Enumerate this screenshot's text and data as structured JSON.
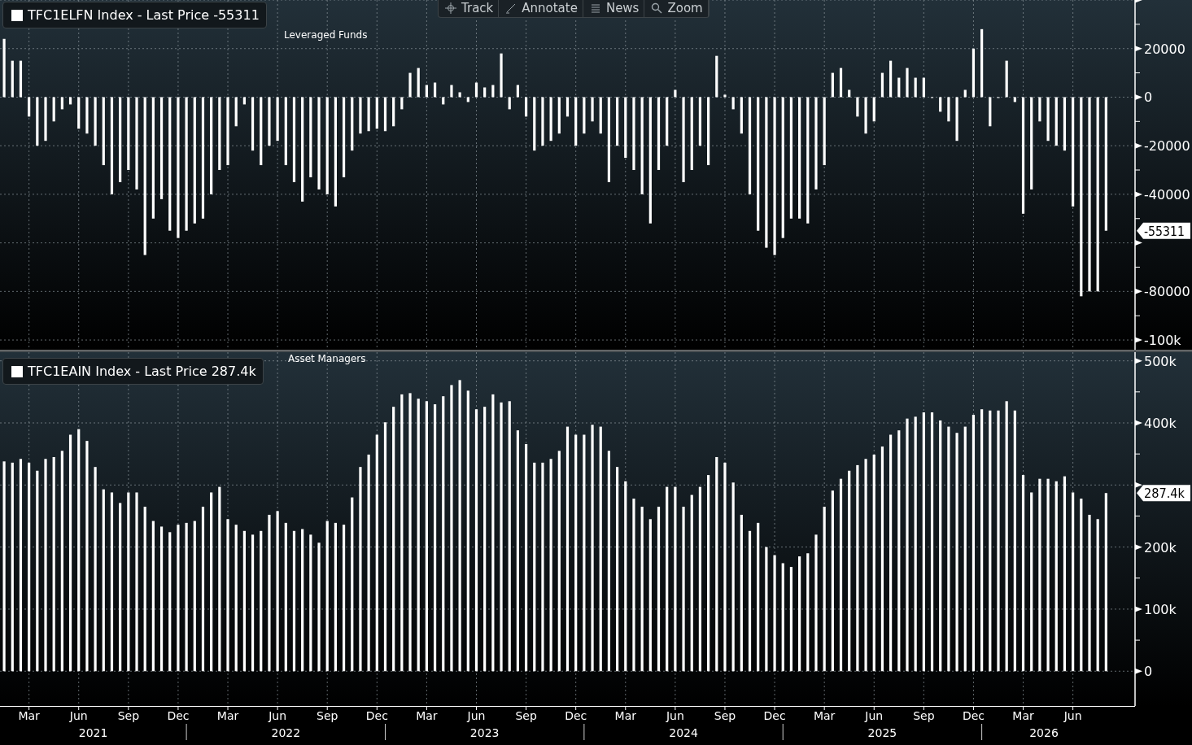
{
  "toolbar": [
    {
      "label": "Track",
      "kind": "track"
    },
    {
      "label": "Annotate",
      "kind": "annotate"
    },
    {
      "label": "News",
      "kind": "news"
    },
    {
      "label": "Zoom",
      "kind": "zoom"
    }
  ],
  "panels": [
    {
      "legend": "TFC1ELFN Index - Last Price -55311",
      "subtitle": "Leveraged Funds",
      "last_tag": "-55311",
      "chart_data": {
        "type": "bar",
        "grid": true,
        "ylim": [
          -104000,
          40000
        ],
        "yticks": [
          {
            "value": 20000,
            "label": "20000"
          },
          {
            "value": 0,
            "label": "0"
          },
          {
            "value": -20000,
            "label": "-20000"
          },
          {
            "value": -40000,
            "label": "-40000"
          },
          {
            "value": -80000,
            "label": "-80000"
          },
          {
            "value": -100000,
            "label": "-100k"
          }
        ],
        "categories": [
          null,
          null,
          null,
          null,
          null,
          null,
          null,
          null,
          null,
          null,
          null,
          null,
          null,
          null,
          null,
          null,
          null,
          null,
          null,
          null,
          null,
          null,
          null,
          null,
          null,
          null,
          null,
          null,
          null,
          null,
          null,
          null,
          null,
          null,
          null,
          null,
          null,
          null,
          null,
          null,
          null,
          null,
          null,
          null,
          null,
          null,
          null,
          null,
          null,
          null,
          null,
          null,
          null,
          null,
          null,
          null,
          null,
          null,
          null,
          null,
          null,
          null,
          null,
          null,
          null,
          null,
          null,
          null,
          null,
          null,
          null,
          null,
          null,
          null,
          null,
          null,
          null,
          null,
          null,
          null,
          null,
          null,
          null,
          null,
          null,
          null,
          null,
          null,
          null,
          null,
          null,
          null,
          null,
          null,
          null,
          null,
          null,
          null,
          null,
          null,
          null,
          null,
          null,
          null,
          null,
          null,
          null,
          null,
          null,
          null,
          null,
          null,
          null,
          null,
          null,
          null,
          null,
          null,
          null,
          null,
          null,
          null,
          null,
          null,
          null,
          null,
          null,
          null,
          null,
          null,
          null,
          null,
          null,
          null,
          null,
          null,
          null
        ],
        "series": [
          {
            "color": "#ffffff",
            "values": [
              24000,
              15000,
              15000,
              -8000,
              -20000,
              -18000,
              -10000,
              -5000,
              -3000,
              -13000,
              -15000,
              -20000,
              -28000,
              -40000,
              -35000,
              -30000,
              -38000,
              -65000,
              -50000,
              -42000,
              -55000,
              -58000,
              -55000,
              -52000,
              -50000,
              -40000,
              -30000,
              -28000,
              -12000,
              -3000,
              -22000,
              -28000,
              -20000,
              -18000,
              -28000,
              -35000,
              -43000,
              -33000,
              -38000,
              -40000,
              -45000,
              -33000,
              -22000,
              -15000,
              -14000,
              -13000,
              -14000,
              -12000,
              -5000,
              10000,
              12000,
              5000,
              6000,
              -3000,
              5000,
              2000,
              -2000,
              6000,
              4000,
              5000,
              18000,
              -5000,
              5000,
              -8000,
              -22000,
              -20000,
              -18000,
              -15000,
              -8000,
              -20000,
              -15000,
              -10000,
              -15000,
              -35000,
              -20000,
              -25000,
              -30000,
              -40000,
              -52000,
              -30000,
              -20000,
              3000,
              -35000,
              -30000,
              -20000,
              -28000,
              17000,
              1000,
              -5000,
              -15000,
              -40000,
              -55000,
              -62000,
              -65000,
              -58000,
              -50000,
              -50000,
              -52000,
              -38000,
              -28000,
              10000,
              12000,
              3000,
              -8000,
              -15000,
              -10000,
              10000,
              15000,
              8000,
              12000,
              8000,
              8000,
              0,
              -6000,
              -10000,
              -18000,
              3000,
              20000,
              28000,
              -12000,
              0,
              15000,
              -2000,
              -48000,
              -38000,
              -10000,
              -18000,
              -20000,
              -22000,
              -45000,
              -82000,
              -80000,
              -80000,
              -55000,
              null,
              null,
              null
            ]
          }
        ]
      }
    },
    {
      "legend": "TFC1EAIN Index - Last Price 287.4k",
      "subtitle": "Asset Managers",
      "last_tag": "287.4k",
      "chart_data": {
        "type": "bar",
        "grid": true,
        "ylim": [
          -56000,
          514000
        ],
        "yticks": [
          {
            "value": 500000,
            "label": "500k"
          },
          {
            "value": 400000,
            "label": "400k"
          },
          {
            "value": 200000,
            "label": "200k"
          },
          {
            "value": 100000,
            "label": "100k"
          },
          {
            "value": 0,
            "label": "0"
          }
        ],
        "categories": [
          null,
          null,
          null,
          "Mar",
          null,
          null,
          null,
          null,
          null,
          "Jun",
          null,
          null,
          null,
          null,
          null,
          "Sep",
          null,
          null,
          null,
          null,
          null,
          "Dec",
          null,
          null,
          null,
          null,
          null,
          "Mar",
          null,
          null,
          null,
          null,
          null,
          "Jun",
          null,
          null,
          null,
          null,
          null,
          "Sep",
          null,
          null,
          null,
          null,
          null,
          "Dec",
          null,
          null,
          null,
          null,
          null,
          "Mar",
          null,
          null,
          null,
          null,
          null,
          "Jun",
          null,
          null,
          null,
          null,
          null,
          "Sep",
          null,
          null,
          null,
          null,
          null,
          "Dec",
          null,
          null,
          null,
          null,
          null,
          "Mar",
          null,
          null,
          null,
          null,
          null,
          "Jun",
          null,
          null,
          null,
          null,
          null,
          "Sep",
          null,
          null,
          null,
          null,
          null,
          "Dec",
          null,
          null,
          null,
          null,
          null,
          "Mar",
          null,
          null,
          null,
          null,
          null,
          "Jun",
          null,
          null,
          null,
          null,
          null,
          "Sep",
          null,
          null,
          null,
          null,
          null,
          "Dec",
          null,
          null,
          null,
          null,
          null,
          "Mar",
          null,
          null,
          null,
          null,
          null,
          "Jun",
          null,
          null,
          null,
          null,
          null,
          null,
          null
        ],
        "series": [
          {
            "color": "#ffffff",
            "values": [
              338000,
              336000,
              342000,
              336000,
              323000,
              342000,
              345000,
              355000,
              381000,
              390000,
              371000,
              329000,
              293000,
              288000,
              271000,
              288000,
              288000,
              265000,
              242000,
              233000,
              224000,
              236000,
              239000,
              242000,
              265000,
              288000,
              297000,
              245000,
              236000,
              226000,
              220000,
              226000,
              252000,
              258000,
              239000,
              226000,
              229000,
              220000,
              207000,
              242000,
              239000,
              236000,
              280000,
              329000,
              349000,
              381000,
              401000,
              426000,
              446000,
              448000,
              439000,
              435000,
              430000,
              443000,
              461000,
              469000,
              452000,
              422000,
              426000,
              446000,
              433000,
              435000,
              388000,
              366000,
              336000,
              336000,
              342000,
              355000,
              394000,
              381000,
              381000,
              397000,
              394000,
              355000,
              329000,
              306000,
              278000,
              265000,
              245000,
              265000,
              297000,
              297000,
              265000,
              284000,
              297000,
              316000,
              345000,
              336000,
              304000,
              252000,
              226000,
              239000,
              200000,
              187000,
              174000,
              168000,
              185000,
              190000,
              220000,
              265000,
              291000,
              310000,
              323000,
              332000,
              342000,
              349000,
              362000,
              381000,
              388000,
              407000,
              410000,
              417000,
              417000,
              404000,
              394000,
              384000,
              394000,
              413000,
              422000,
              420000,
              420000,
              435000,
              420000,
              316000,
              288000,
              310000,
              310000,
              306000,
              314000,
              288000,
              278000,
              252000,
              245000,
              287000,
              null,
              null,
              null
            ]
          }
        ]
      }
    }
  ],
  "years": [
    "2021",
    "2022",
    "2023",
    "2024",
    "2025",
    "2026"
  ]
}
